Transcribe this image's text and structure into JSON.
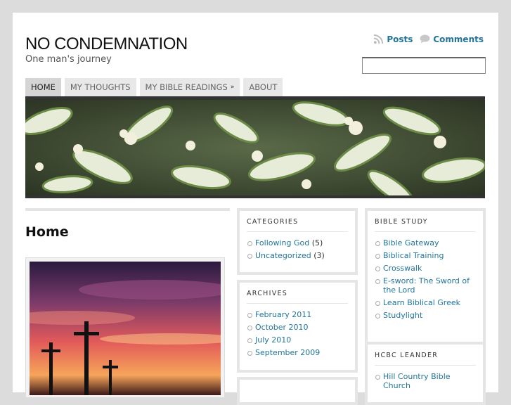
{
  "header": {
    "site_title": "NO CONDEMNATION",
    "site_description": "One man's journey",
    "feeds": {
      "posts_label": "Posts",
      "comments_label": "Comments"
    },
    "search": {
      "value": ""
    }
  },
  "nav": {
    "items": [
      {
        "label": "Home"
      },
      {
        "label": "My Thoughts"
      },
      {
        "label": "My Bible Readings"
      },
      {
        "label": "About"
      }
    ]
  },
  "main": {
    "page_title": "Home"
  },
  "sidebar": {
    "categories": {
      "title": "Categories",
      "items": [
        {
          "label": "Following God",
          "count": "(5)"
        },
        {
          "label": "Uncategorized",
          "count": "(3)"
        }
      ]
    },
    "archives": {
      "title": "Archives",
      "items": [
        {
          "label": "February 2011"
        },
        {
          "label": "October 2010"
        },
        {
          "label": "July 2010"
        },
        {
          "label": "September 2009"
        }
      ]
    },
    "bible_study": {
      "title": "Bible Study",
      "items": [
        {
          "label": "Bible Gateway"
        },
        {
          "label": "Biblical Training"
        },
        {
          "label": "Crosswalk"
        },
        {
          "label": "E-sword: The Sword of the Lord"
        },
        {
          "label": "Learn Biblical Greek"
        },
        {
          "label": "Studylight"
        }
      ]
    },
    "hcbc": {
      "title": "HCBC Leander",
      "items": [
        {
          "label": "Hill Country Bible Church"
        }
      ]
    }
  },
  "colors": {
    "link": "#21759b",
    "header_bar": "#333333",
    "page_bg": "#dcdcdc"
  }
}
